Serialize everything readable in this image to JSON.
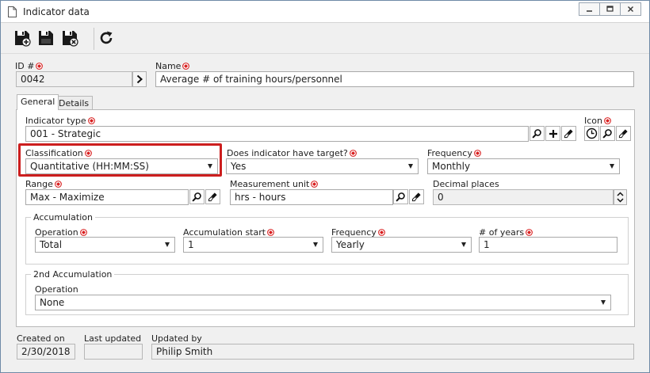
{
  "window": {
    "title": "Indicator data"
  },
  "toolbar": {
    "buttons": [
      {
        "icon": "save-new-icon",
        "label": "Save and new"
      },
      {
        "icon": "save-icon",
        "label": "Save"
      },
      {
        "icon": "save-close-icon",
        "label": "Save and close"
      },
      {
        "icon": "refresh-icon",
        "label": "Refresh"
      }
    ]
  },
  "header": {
    "id_label": "ID #",
    "id_value": "0042",
    "name_label": "Name",
    "name_value": "Average # of training hours/personnel"
  },
  "tabs": [
    {
      "label": "General",
      "active": true
    },
    {
      "label": "Details",
      "active": false
    }
  ],
  "general": {
    "indicator_type_label": "Indicator type",
    "indicator_type_value": "001 - Strategic",
    "icon_label": "Icon",
    "classification_label": "Classification",
    "classification_value": "Quantitative (HH:MM:SS)",
    "has_target_label": "Does indicator have target?",
    "has_target_value": "Yes",
    "frequency_label": "Frequency",
    "frequency_value": "Monthly",
    "range_label": "Range",
    "range_value": "Max - Maximize",
    "unit_label": "Measurement unit",
    "unit_value": "hrs - hours",
    "decimal_label": "Decimal places",
    "decimal_value": "0",
    "accumulation": {
      "legend": "Accumulation",
      "operation_label": "Operation",
      "operation_value": "Total",
      "start_label": "Accumulation start",
      "start_value": "1",
      "frequency_label": "Frequency",
      "frequency_value": "Yearly",
      "years_label": "# of years",
      "years_value": "1"
    },
    "accumulation2": {
      "legend": "2nd Accumulation",
      "operation_label": "Operation",
      "operation_value": "None"
    }
  },
  "footer": {
    "created_label": "Created on",
    "created_value": "2/30/2018",
    "updated_label": "Last updated",
    "updated_value": "",
    "updated_by_label": "Updated by",
    "updated_by_value": "Philip Smith"
  },
  "colors": {
    "required": "#d92020",
    "highlight": "#cc1e1e",
    "frame": "#6f8aa6"
  }
}
